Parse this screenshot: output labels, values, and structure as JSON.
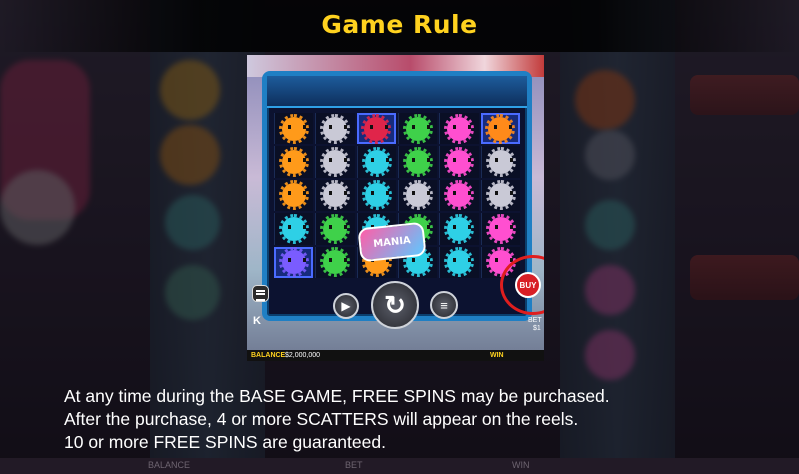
{
  "title": "Game Rule",
  "rule_lines": [
    "At any time during the BASE GAME, FREE SPINS may be purchased.",
    "After the purchase, 4 or more SCATTERS will appear on the reels.",
    "10 or more FREE SPINS are guaranteed."
  ],
  "screenshot": {
    "logo_text": "MANIA",
    "buy_label": "BUY",
    "bet_label": "BET",
    "bet_value": "$1",
    "balance_label": "BALANCE",
    "balance_value": "$2,000,000",
    "win_label": "WIN",
    "grid_colors": [
      [
        "#ff9a1a",
        "#c9c9d6",
        "#e0254a",
        "#3fd14a",
        "#ff4fd0",
        "#ff8a1a"
      ],
      [
        "#ff9a1a",
        "#c9c9d6",
        "#2ed0e6",
        "#3fd14a",
        "#ff4fd0",
        "#c9c9d6"
      ],
      [
        "#ff9a1a",
        "#c9c9d6",
        "#2ed0e6",
        "#c9c9d6",
        "#ff4fd0",
        "#c9c9d6"
      ],
      [
        "#2ed0e6",
        "#3fd14a",
        "#2ed0e6",
        "#3fd14a",
        "#2ed0e6",
        "#ff4fd0"
      ],
      [
        "#7a5cff",
        "#3fd14a",
        "#ff9a1a",
        "#2ed0e6",
        "#2ed0e6",
        "#ff4fd0"
      ]
    ]
  },
  "background_text": [
    "BALANCE",
    "BET",
    "WIN"
  ],
  "colors": {
    "title": "#ffd21f",
    "text": "#ffffff",
    "buy_highlight": "#e01e1e"
  }
}
